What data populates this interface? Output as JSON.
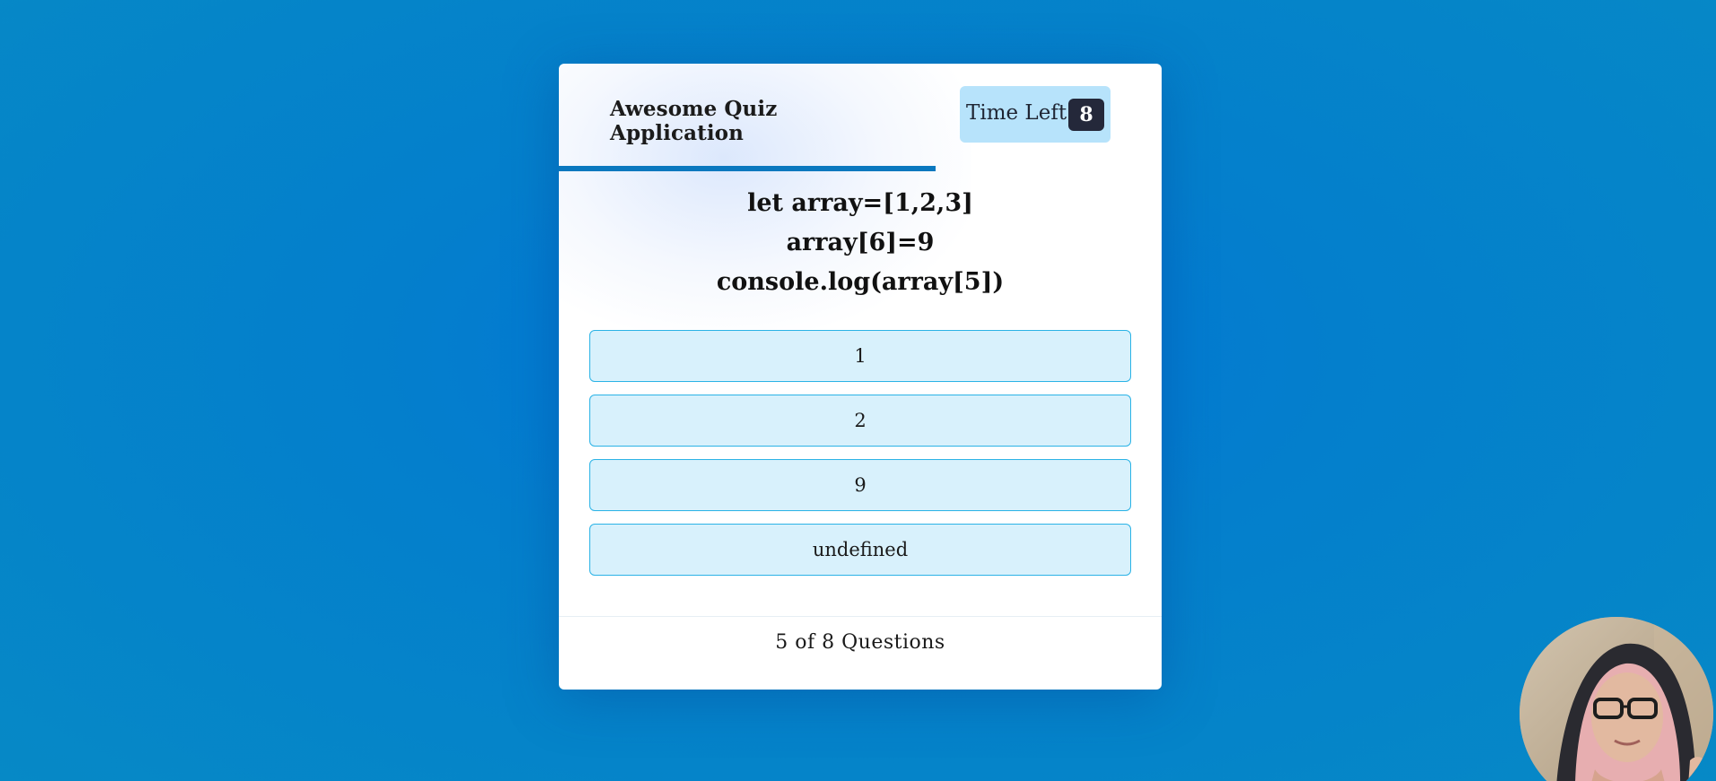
{
  "header": {
    "title": "Awesome Quiz Application",
    "timer_label": "Time Left",
    "timer_value": "8"
  },
  "progress": {
    "fraction": 0.625,
    "color": "#0a78bf"
  },
  "question": {
    "lines": [
      "let array=[1,2,3]",
      "array[6]=9",
      "console.log(array[5])"
    ]
  },
  "options": [
    "1",
    "2",
    "9",
    "undefined"
  ],
  "footer": {
    "current": "5",
    "total": "8",
    "text": "5 of 8 Questions"
  },
  "colors": {
    "background": "#0486c8",
    "card": "#ffffff",
    "timer_bg": "#b7e3fb",
    "timer_count_bg": "#24283a",
    "option_bg": "#d8f1fc",
    "option_border": "#2bb3e6"
  },
  "webcam": {
    "icon": "webcam-avatar"
  }
}
